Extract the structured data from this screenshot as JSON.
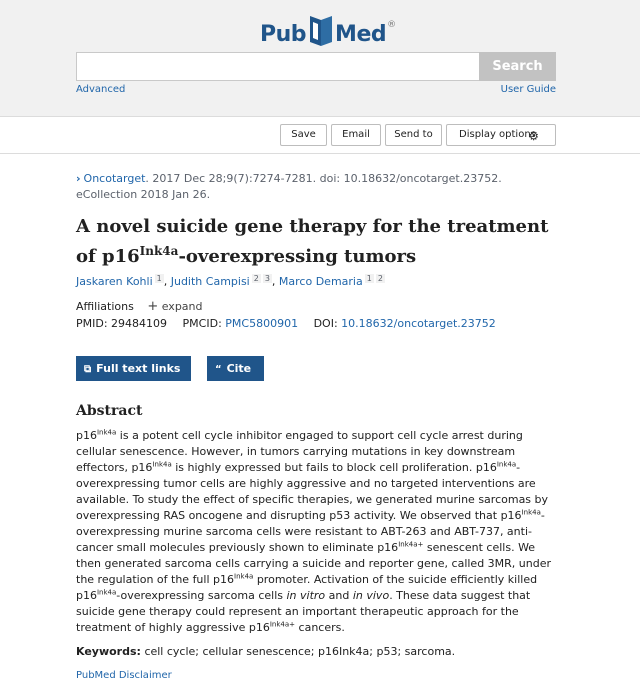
{
  "header": {
    "logo_part1": "Pub",
    "logo_part2": "Med",
    "logo_reg": "®",
    "search_value": "",
    "search_button": "Search",
    "advanced_link": "Advanced",
    "user_guide_link": "User Guide"
  },
  "toolbar": {
    "save": "Save",
    "email": "Email",
    "send_to": "Send to",
    "display_options": "Display options",
    "display_icon": "gear-icon"
  },
  "article": {
    "journal": "Oncotarget",
    "citation_rest": ". 2017 Dec 28;9(7):7274-7281. doi: 10.18632/oncotarget.23752.",
    "ecollection": "eCollection 2018 Jan 26.",
    "title_part1": "A novel suicide gene therapy for the treatment of p16",
    "title_sup": "Ink4a",
    "title_part2": "-overexpressing tumors",
    "authors": [
      {
        "name": "Jaskaren Kohli",
        "affs": [
          "1"
        ]
      },
      {
        "name": "Judith Campisi",
        "affs": [
          "2",
          "3"
        ]
      },
      {
        "name": "Marco Demaria",
        "affs": [
          "1",
          "2"
        ]
      }
    ],
    "affiliations_label": "Affiliations",
    "expand_label": "expand",
    "pmid_label": "PMID:",
    "pmid": "29484109",
    "pmcid_label": "PMCID:",
    "pmcid": "PMC5800901",
    "doi_label": "DOI:",
    "doi": "10.18632/oncotarget.23752"
  },
  "actions": {
    "full_text": "Full text links",
    "cite": "Cite"
  },
  "abstract": {
    "heading": "Abstract",
    "p16": "p16",
    "ink": "Ink4a",
    "inkplus": "Ink4a+",
    "s1": " is a potent cell cycle inhibitor engaged to support cell cycle arrest during cellular senescence. However, in tumors carrying mutations in key downstream effectors, ",
    "s2": " is highly expressed but fails to block cell proliferation. ",
    "s3": "-overexpressing tumor cells are highly aggressive and no targeted interventions are available. To study the effect of specific therapies, we generated murine sarcomas by overexpressing RAS oncogene and disrupting p53 activity. We observed that ",
    "s4": "-overexpressing murine sarcoma cells were resistant to ABT-263 and ABT-737, anti-cancer small molecules previously shown to eliminate ",
    "s5": " senescent cells. We then generated sarcoma cells carrying a suicide and reporter gene, called 3MR, under the regulation of the full ",
    "s6": " promoter. Activation of the suicide efficiently killed ",
    "s7": "-overexpressing sarcoma cells ",
    "invitro": "in vitro",
    "and": " and ",
    "invivo": "in vivo",
    "s8": ". These data suggest that suicide gene therapy could represent an important therapeutic approach for the treatment of highly aggressive ",
    "s9": " cancers."
  },
  "keywords": {
    "label": "Keywords:",
    "text": "cell cycle; cellular senescence; p16Ink4a; p53; sarcoma."
  },
  "footer": {
    "disclaimer": "PubMed Disclaimer"
  },
  "colors": {
    "brand": "#20558a",
    "link": "#2166aa",
    "header_bg": "#f1f1f1"
  }
}
